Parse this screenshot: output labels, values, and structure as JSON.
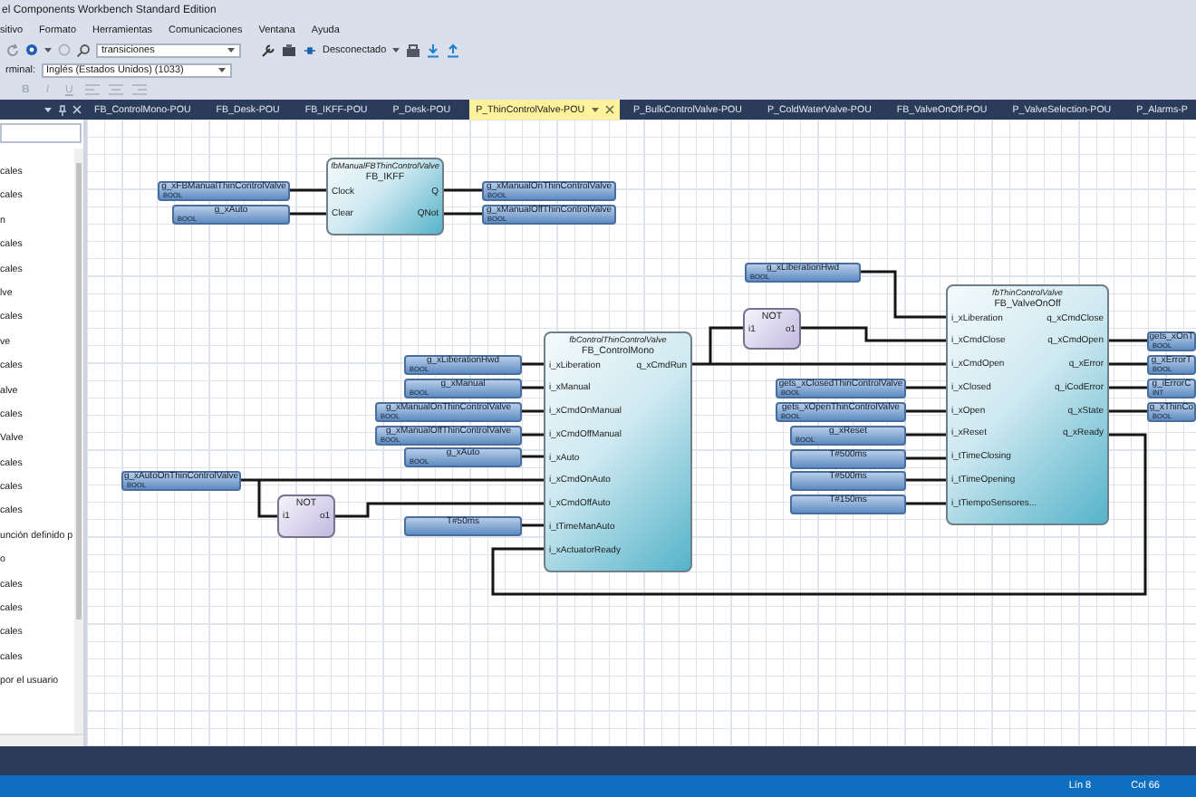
{
  "window": {
    "title": "el Components Workbench Standard Edition"
  },
  "menu": [
    "sitivo",
    "Formato",
    "Herramientas",
    "Comunicaciones",
    "Ventana",
    "Ayuda"
  ],
  "toolbar": {
    "search": {
      "value": "transiciones"
    },
    "connection": "Desconectado"
  },
  "terminal": {
    "label": "rminal:",
    "value": "Inglés (Estados Unidos) (1033)"
  },
  "format_buttons": [
    "B",
    "I",
    "U"
  ],
  "panel": {
    "items": [
      "cales",
      "cales",
      "n",
      "cales",
      "cales",
      "lve",
      "cales",
      "ve",
      "cales",
      "alve",
      "cales",
      "Valve",
      "cales",
      "cales",
      "cales",
      "unción definido p",
      "o",
      "cales",
      "cales",
      "cales",
      "cales",
      "por el usuario"
    ]
  },
  "tabs": [
    {
      "label": "FB_ControlMono-POU",
      "selected": false
    },
    {
      "label": "FB_Desk-POU",
      "selected": false
    },
    {
      "label": "FB_IKFF-POU",
      "selected": false
    },
    {
      "label": "P_Desk-POU",
      "selected": false
    },
    {
      "label": "P_ThinControlValve-POU",
      "selected": true
    },
    {
      "label": "P_BulkControlValve-POU",
      "selected": false
    },
    {
      "label": "P_ColdWaterValve-POU",
      "selected": false
    },
    {
      "label": "FB_ValveOnOff-POU",
      "selected": false
    },
    {
      "label": "P_ValveSelection-POU",
      "selected": false
    },
    {
      "label": "P_Alarms-P",
      "selected": false
    }
  ],
  "diagram": {
    "blocks": [
      {
        "kind": "function_block",
        "instance": "fbManualFBThinControlValve",
        "type": "FB_IKFF",
        "inputs": [
          "Clock",
          "Clear"
        ],
        "outputs": [
          "Q",
          "QNot"
        ]
      },
      {
        "kind": "operator",
        "type": "NOT",
        "inputs": [
          "i1"
        ],
        "outputs": [
          "o1"
        ]
      },
      {
        "kind": "function_block",
        "instance": "fbControlThinControlValve",
        "type": "FB_ControlMono",
        "inputs": [
          "i_xLiberation",
          "i_xManual",
          "i_xCmdOnManual",
          "i_xCmdOffManual",
          "i_xAuto",
          "i_xCmdOnAuto",
          "i_xCmdOffAuto",
          "i_tTimeManAuto",
          "i_xActuatorReady"
        ],
        "outputs": [
          "q_xCmdRun"
        ]
      },
      {
        "kind": "operator",
        "type": "NOT",
        "inputs": [
          "i1"
        ],
        "outputs": [
          "o1"
        ]
      },
      {
        "kind": "function_block",
        "instance": "fbThinControlValve",
        "type": "FB_ValveOnOff",
        "inputs": [
          "i_xLiberation",
          "i_xCmdClose",
          "i_xCmdOpen",
          "i_xClosed",
          "i_xOpen",
          "i_xReset",
          "i_tTimeClosing",
          "i_tTimeOpening",
          "i_tTiempoSensores..."
        ],
        "outputs": [
          "q_xCmdClose",
          "q_xCmdOpen",
          "q_xError",
          "q_iCodError",
          "q_xState",
          "q_xReady"
        ]
      }
    ],
    "variables": [
      {
        "name": "g_xFBManualThinControlValve",
        "data_type": "BOOL"
      },
      {
        "name": "g_xAuto",
        "data_type": "BOOL"
      },
      {
        "name": "g_xManualOnThinControlValve",
        "data_type": "BOOL"
      },
      {
        "name": "g_xManualOffThinControlValve",
        "data_type": "BOOL"
      },
      {
        "name": "g_xLiberationHwd",
        "data_type": "BOOL"
      },
      {
        "name": "g_xManual",
        "data_type": "BOOL"
      },
      {
        "name": "g_xManualOnThinControlValve",
        "data_type": "BOOL"
      },
      {
        "name": "g_xManualOffThinControlValve",
        "data_type": "BOOL"
      },
      {
        "name": "g_xAuto",
        "data_type": "BOOL"
      },
      {
        "name": "g_xAutoOnThinControlValve",
        "data_type": "BOOL"
      },
      {
        "name": "T#50ms"
      },
      {
        "name": "g_xLiberationHwd",
        "data_type": "BOOL"
      },
      {
        "name": "gets_xClosedThinControlValve",
        "data_type": "BOOL"
      },
      {
        "name": "gets_xOpenThinControlValve",
        "data_type": "BOOL"
      },
      {
        "name": "g_xReset",
        "data_type": "BOOL"
      },
      {
        "name": "T#500ms"
      },
      {
        "name": "T#500ms"
      },
      {
        "name": "T#150ms"
      },
      {
        "name": "gets_xOnT",
        "data_type": "BOOL"
      },
      {
        "name": "g_xErrorT",
        "data_type": "BOOL"
      },
      {
        "name": "g_iErrorC",
        "data_type": "INT"
      },
      {
        "name": "g_xThinCo",
        "data_type": "BOOL"
      }
    ]
  },
  "status_bar": {
    "line": "Lín 8",
    "column": "Col 66"
  }
}
